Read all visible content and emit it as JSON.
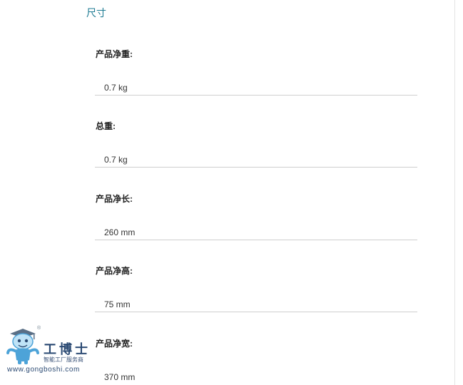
{
  "section": {
    "title": "尺寸"
  },
  "specs": [
    {
      "label": "产品净重:",
      "value": "0.7 kg"
    },
    {
      "label": "总重:",
      "value": "0.7 kg"
    },
    {
      "label": "产品净长:",
      "value": "260 mm"
    },
    {
      "label": "产品净高:",
      "value": "75 mm"
    },
    {
      "label": "产品净宽:",
      "value": "370 mm"
    }
  ],
  "watermark": {
    "brand": "工博士",
    "registered_mark": "®",
    "slogan": "智能工厂服务商",
    "url": "www.gongboshi.com",
    "mascot_icon": "robot-mascot-icon",
    "colors": {
      "brand": "#2b4a73",
      "mascot": "#4da3d8"
    }
  },
  "colors": {
    "section_title": "#1e7b93",
    "rule": "#cfcfcf"
  }
}
